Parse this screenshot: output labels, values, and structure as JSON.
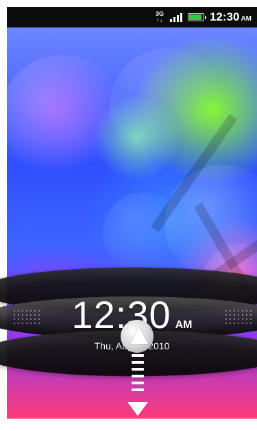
{
  "status_bar": {
    "network": "3G",
    "time": "12:30",
    "ampm": "AM"
  },
  "lock_screen": {
    "time": "12:30",
    "ampm": "AM",
    "date": "Thu, August 2010"
  },
  "icons": {
    "network": "network-3g-icon",
    "signal": "signal-strength-icon",
    "battery": "battery-icon",
    "unlock_knob": "unlock-knob-icon",
    "drag_arrow": "drag-down-arrow-icon"
  },
  "colors": {
    "status_bar_bg": "#0b0b0b",
    "battery_green": "#2ecc40"
  }
}
